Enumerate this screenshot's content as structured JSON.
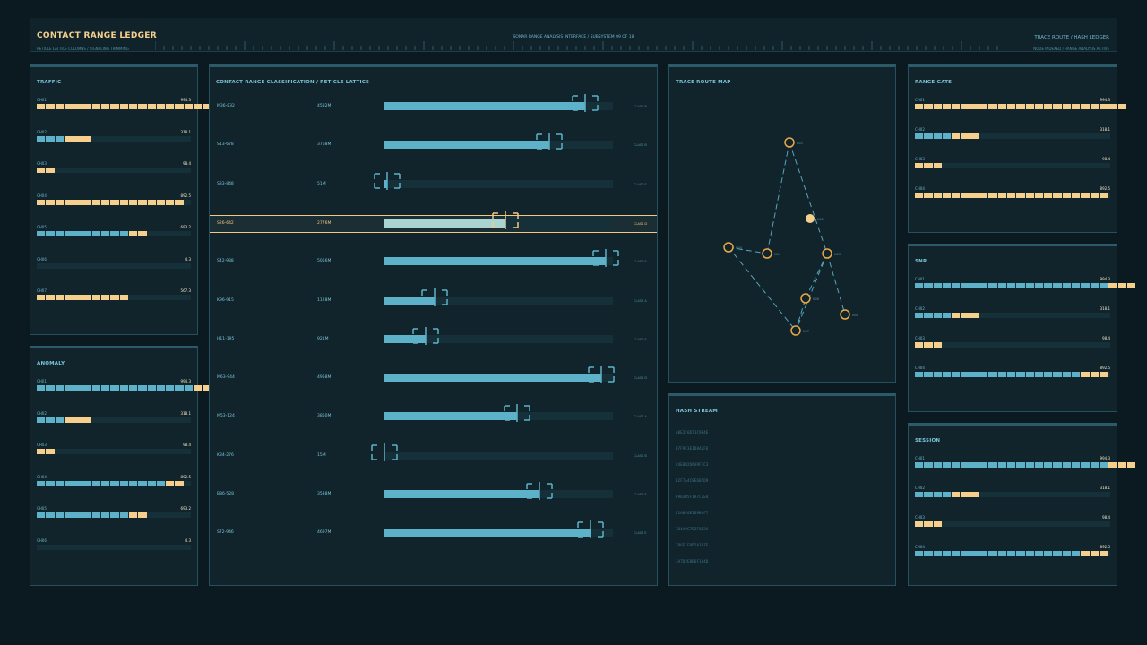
{
  "header": {
    "title": "CONTACT RANGE LEDGER",
    "subtitle": "RETICLE LATTICE COLUMNS / SIGNALING TRIMMING",
    "center": "SONAR RANGE ANALYSIS INTERFACE / SUBSYSTEM 09 OF 18",
    "right_title": "TRACE ROUTE / HASH LEDGER",
    "right_sub": "NODE INDEXED / RANGE ANALYSIS ACTIVE"
  },
  "colors": {
    "accent": "#f6cf8d",
    "teal": "#5db1c8",
    "bg": "#0b1a20",
    "panel": "#11242c"
  },
  "left_panels": [
    {
      "title": "TRAFFIC",
      "rows": [
        {
          "label": "CH01",
          "value": "994.3",
          "teal": 0,
          "orange": 19
        },
        {
          "label": "CH02",
          "value": "318.1",
          "teal": 3,
          "orange": 3
        },
        {
          "label": "CH03",
          "value": "98.4",
          "teal": 0,
          "orange": 2
        },
        {
          "label": "CH04",
          "value": "892.5",
          "teal": 0,
          "orange": 16
        },
        {
          "label": "CH05",
          "value": "693.2",
          "teal": 10,
          "orange": 2
        },
        {
          "label": "CH06",
          "value": "4.3",
          "teal": 0,
          "orange": 0
        },
        {
          "label": "CH07",
          "value": "567.3",
          "teal": 0,
          "orange": 10
        }
      ]
    },
    {
      "title": "ANOMALY",
      "rows": [
        {
          "label": "CH01",
          "value": "994.3",
          "teal": 17,
          "orange": 2
        },
        {
          "label": "CH02",
          "value": "318.1",
          "teal": 3,
          "orange": 3
        },
        {
          "label": "CH03",
          "value": "98.4",
          "teal": 0,
          "orange": 2
        },
        {
          "label": "CH04",
          "value": "892.5",
          "teal": 14,
          "orange": 2
        },
        {
          "label": "CH05",
          "value": "693.2",
          "teal": 10,
          "orange": 2
        },
        {
          "label": "CH06",
          "value": "4.3",
          "teal": 0,
          "orange": 0
        }
      ]
    }
  ],
  "contact": {
    "title": "CONTACT RANGE CLASSIFICATION / RETICLE LATTICE",
    "rows": [
      {
        "id": "M36-832",
        "range": "4532M",
        "cls": "CLASS B",
        "pct": 0.88,
        "selected": false
      },
      {
        "id": "S13-678",
        "range": "3768M",
        "cls": "CLASS B",
        "pct": 0.72,
        "selected": false
      },
      {
        "id": "S33-848",
        "range": "51M",
        "cls": "CLASS E",
        "pct": 0.01,
        "selected": false
      },
      {
        "id": "S26-642",
        "range": "2776M",
        "cls": "CLASS D",
        "pct": 0.53,
        "selected": true
      },
      {
        "id": "S42-938",
        "range": "5056M",
        "cls": "CLASS E",
        "pct": 0.97,
        "selected": false
      },
      {
        "id": "K96-915",
        "range": "1128M",
        "cls": "CLASS A",
        "pct": 0.22,
        "selected": false
      },
      {
        "id": "H11-195",
        "range": "921M",
        "cls": "CLASS E",
        "pct": 0.18,
        "selected": false
      },
      {
        "id": "M63-944",
        "range": "4958M",
        "cls": "CLASS D",
        "pct": 0.95,
        "selected": false
      },
      {
        "id": "M53-124",
        "range": "3850M",
        "cls": "CLASS A",
        "pct": 0.58,
        "selected": false
      },
      {
        "id": "K34-276",
        "range": "15M",
        "cls": "CLASS B",
        "pct": 0.0,
        "selected": false
      },
      {
        "id": "B86-528",
        "range": "3538M",
        "cls": "CLASS E",
        "pct": 0.68,
        "selected": false
      },
      {
        "id": "S72-946",
        "range": "4697M",
        "cls": "CLASS E",
        "pct": 0.9,
        "selected": false
      }
    ]
  },
  "trace": {
    "title": "TRACE ROUTE MAP",
    "nodes": [
      {
        "label": "N01"
      },
      {
        "label": "N02"
      },
      {
        "label": "N03"
      },
      {
        "label": "N04"
      },
      {
        "label": "N05"
      },
      {
        "label": "N06"
      },
      {
        "label": "N07"
      },
      {
        "label": "N08"
      }
    ]
  },
  "hash": {
    "title": "HASH STREAM",
    "lines": [
      "A8E2F6D71C9B4E",
      "B7F9C3E1D8A2F6",
      "C4E8B2D6A9F1C3",
      "D2F7A4C8E6B1D9",
      "E9B3D5F1A7C2E8",
      "F1A8C6E3D9B4F7",
      "1D4A9C7E2F8B3A",
      "2B6E1F9D5A3C7E",
      "3A7D2E8B6F1C4D"
    ]
  },
  "right_panels": [
    {
      "title": "RANGE GATE",
      "rows": [
        {
          "label": "CH01",
          "value": "994.3",
          "teal": 0,
          "orange": 23
        },
        {
          "label": "CH02",
          "value": "318.1",
          "teal": 4,
          "orange": 3
        },
        {
          "label": "CH03",
          "value": "98.4",
          "teal": 0,
          "orange": 3
        },
        {
          "label": "CH04",
          "value": "892.5",
          "teal": 0,
          "orange": 21
        }
      ]
    },
    {
      "title": "SNR",
      "rows": [
        {
          "label": "CH01",
          "value": "994.3",
          "teal": 21,
          "orange": 3
        },
        {
          "label": "CH02",
          "value": "318.1",
          "teal": 4,
          "orange": 3
        },
        {
          "label": "CH03",
          "value": "98.4",
          "teal": 0,
          "orange": 3
        },
        {
          "label": "CH04",
          "value": "892.5",
          "teal": 18,
          "orange": 3
        }
      ]
    },
    {
      "title": "SESSION",
      "rows": [
        {
          "label": "CH01",
          "value": "994.3",
          "teal": 21,
          "orange": 3
        },
        {
          "label": "CH02",
          "value": "318.1",
          "teal": 4,
          "orange": 3
        },
        {
          "label": "CH03",
          "value": "98.4",
          "teal": 0,
          "orange": 3
        },
        {
          "label": "CH04",
          "value": "892.5",
          "teal": 18,
          "orange": 3
        }
      ]
    }
  ]
}
